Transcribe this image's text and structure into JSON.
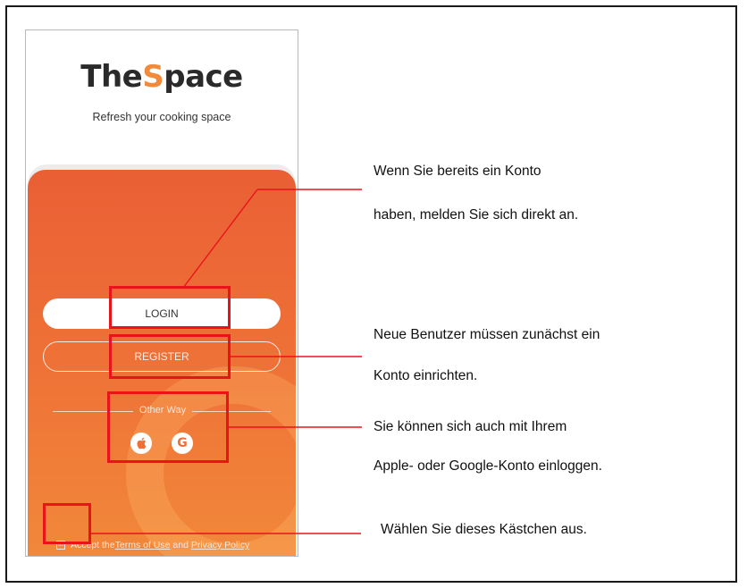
{
  "app": {
    "logo_part1": "The",
    "logo_accent": "S",
    "logo_part2": "pace",
    "tagline": "Refresh your cooking space"
  },
  "buttons": {
    "login": "LOGIN",
    "register": "REGISTER"
  },
  "social": {
    "label": "Other Way",
    "apple_icon": "apple-icon",
    "google_letter": "G"
  },
  "terms": {
    "checkbox": "☑",
    "prefix": "Accept the",
    "terms_link": "Terms of Use",
    "and": " and ",
    "privacy_link": "Privacy Policy"
  },
  "annotations": {
    "login_line1": "Wenn Sie bereits ein Konto",
    "login_line2": "haben, melden Sie sich direkt an.",
    "register_line1": "Neue Benutzer müssen zunächst ein",
    "register_line2": "Konto einrichten.",
    "social_line1": "Sie können sich auch mit Ihrem",
    "social_line2": "Apple- oder Google-Konto einloggen.",
    "terms_line": "Wählen Sie dieses Kästchen aus."
  },
  "colors": {
    "accent": "#ef6f37",
    "highlight": "#e8131b"
  }
}
